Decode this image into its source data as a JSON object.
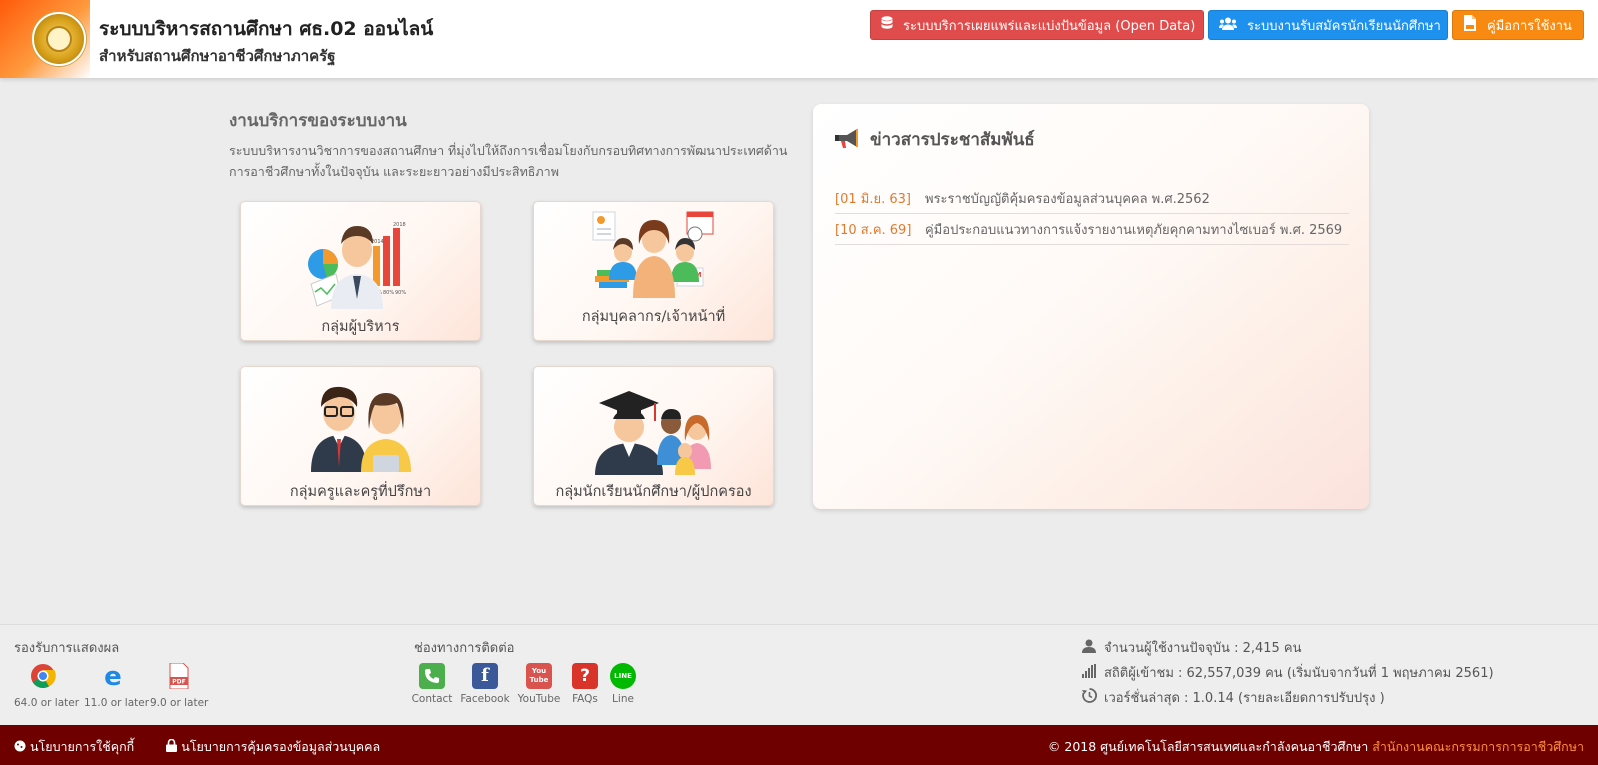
{
  "header": {
    "title": "ระบบบริหารสถานศึกษา ศธ.02 ออนไลน์",
    "subtitle": "สำหรับสถานศึกษาอาชีวศึกษาภาครัฐ",
    "buttons": {
      "open_data": "ระบบบริการเผยแพร่และแบ่งปันข้อมูล (Open Data)",
      "recruit": "ระบบงานรับสมัครนักเรียนนักศึกษา",
      "manual": "คู่มือการใช้งาน"
    }
  },
  "services": {
    "title": "งานบริการของระบบงาน",
    "description": "ระบบบริหารงานวิชาการของสถานศึกษา ที่มุ่งไปให้ถึงการเชื่อมโยงกับกรอบทิศทางการพัฒนาประเทศด้านการอาชีวศึกษาทั้งในปัจจุบัน และระยะยาวอย่างมีประสิทธิภาพ",
    "cards": [
      {
        "label": "กลุ่มผู้บริหาร"
      },
      {
        "label": "กลุ่มบุคลากร/เจ้าหน้าที่"
      },
      {
        "label": "กลุ่มครูและครูที่ปรึกษา"
      },
      {
        "label": "กลุ่มนักเรียนนักศึกษา/ผู้ปกครอง"
      }
    ],
    "chart_tags": [
      "2014",
      "2018",
      "70%",
      "80%",
      "90%"
    ],
    "exam_tag": "EXAM"
  },
  "news": {
    "title": "ข่าวสารประชาสัมพันธ์",
    "items": [
      {
        "date": "[01 มิ.ย. 63]",
        "text": "พระราชบัญญัติคุ้มครองข้อมูลส่วนบุคคล พ.ศ.2562"
      },
      {
        "date": "[10 ส.ค. 69]",
        "text": "คู่มือประกอบแนวทางการแจ้งรายงานเหตุภัยคุกคามทางไซเบอร์ พ.ศ. 2569"
      }
    ]
  },
  "footer": {
    "browsers_title": "รองรับการแสดงผล",
    "browsers": [
      {
        "label": "64.0 or later"
      },
      {
        "label": "11.0 or later"
      },
      {
        "label": "9.0 or later",
        "icon_text": "PDF"
      }
    ],
    "contact_title": "ช่องทางการติดต่อ",
    "contacts": [
      {
        "label": "Contact"
      },
      {
        "label": "Facebook",
        "icon_text": "f"
      },
      {
        "label": "YouTube",
        "icon_text": "You Tube"
      },
      {
        "label": "FAQs",
        "icon_text": "?"
      },
      {
        "label": "Line",
        "icon_text": "LINE"
      }
    ],
    "stats": {
      "users": "จำนวนผู้ใช้งานปัจจุบัน : 2,415 คน",
      "visitors": "สถิติผู้เข้าชม : 62,557,039 คน (เริ่มนับจากวันที่ 1 พฤษภาคม 2561)",
      "version": "เวอร์ชั่นล่าสุด : 1.0.14 (รายละเอียดการปรับปรุง )"
    }
  },
  "bottom_bar": {
    "cookie_policy": "นโยบายการใช้คุกกี้",
    "privacy_policy": "นโยบายการคุ้มครองข้อมูลส่วนบุคคล",
    "copyright": "© 2018 ศูนย์เทคโนโลยีสารสนเทศและกำลังคนอาชีวศึกษา",
    "agency": "สำนักงานคณะกรรมการการอาชีวศึกษา"
  },
  "colors": {
    "open_data_button": "#e04b4b",
    "recruit_button": "#1e90ee",
    "manual_button": "#f98a11",
    "bottom_bar": "#6e0000",
    "news_date": "#e07a2c"
  }
}
